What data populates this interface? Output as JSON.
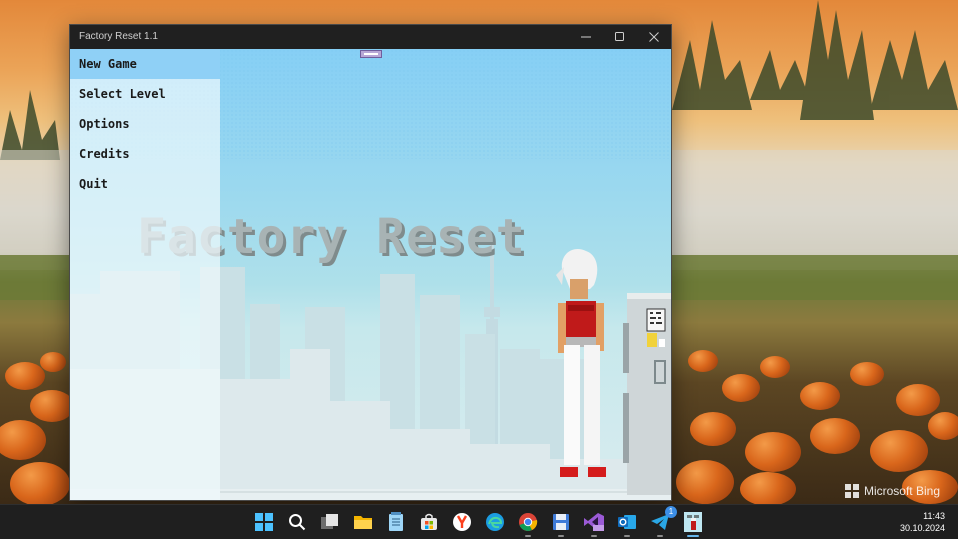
{
  "window": {
    "title": "Factory Reset 1.1",
    "minimize_icon": "minimize-icon",
    "maximize_icon": "maximize-icon",
    "close_icon": "close-icon"
  },
  "game": {
    "title": "Factory Reset",
    "menu": [
      {
        "label": "New Game",
        "selected": true
      },
      {
        "label": "Select Level",
        "selected": false
      },
      {
        "label": "Options",
        "selected": false
      },
      {
        "label": "Credits",
        "selected": false
      },
      {
        "label": "Quit",
        "selected": false
      }
    ],
    "selection_color": "#8fd0f6"
  },
  "desktop": {
    "watermark": "Microsoft Bing"
  },
  "taskbar": {
    "apps": [
      {
        "name": "start",
        "icon": "windows-logo-icon"
      },
      {
        "name": "search",
        "icon": "search-icon"
      },
      {
        "name": "task-view",
        "icon": "task-view-icon"
      },
      {
        "name": "file-explorer",
        "icon": "folder-icon"
      },
      {
        "name": "notepad",
        "icon": "notepad-icon"
      },
      {
        "name": "microsoft-store",
        "icon": "store-icon"
      },
      {
        "name": "yandex-browser",
        "icon": "yandex-icon"
      },
      {
        "name": "edge",
        "icon": "edge-icon"
      },
      {
        "name": "chrome",
        "icon": "chrome-icon"
      },
      {
        "name": "save-app",
        "icon": "floppy-disk-icon"
      },
      {
        "name": "visual-studio-preview",
        "icon": "visual-studio-icon"
      },
      {
        "name": "outlook",
        "icon": "outlook-icon"
      },
      {
        "name": "telegram",
        "icon": "telegram-icon",
        "badge": "1"
      },
      {
        "name": "factory-reset",
        "icon": "factory-reset-app-icon"
      }
    ],
    "clock": {
      "time": "11:43",
      "date": "30.10.2024"
    }
  },
  "colors": {
    "taskbar": "#1f1f1f",
    "titlebar": "#202020",
    "sky_top": "#86cff5",
    "title_text": "#a8b3b4",
    "character_shirt": "#c01a1a"
  }
}
